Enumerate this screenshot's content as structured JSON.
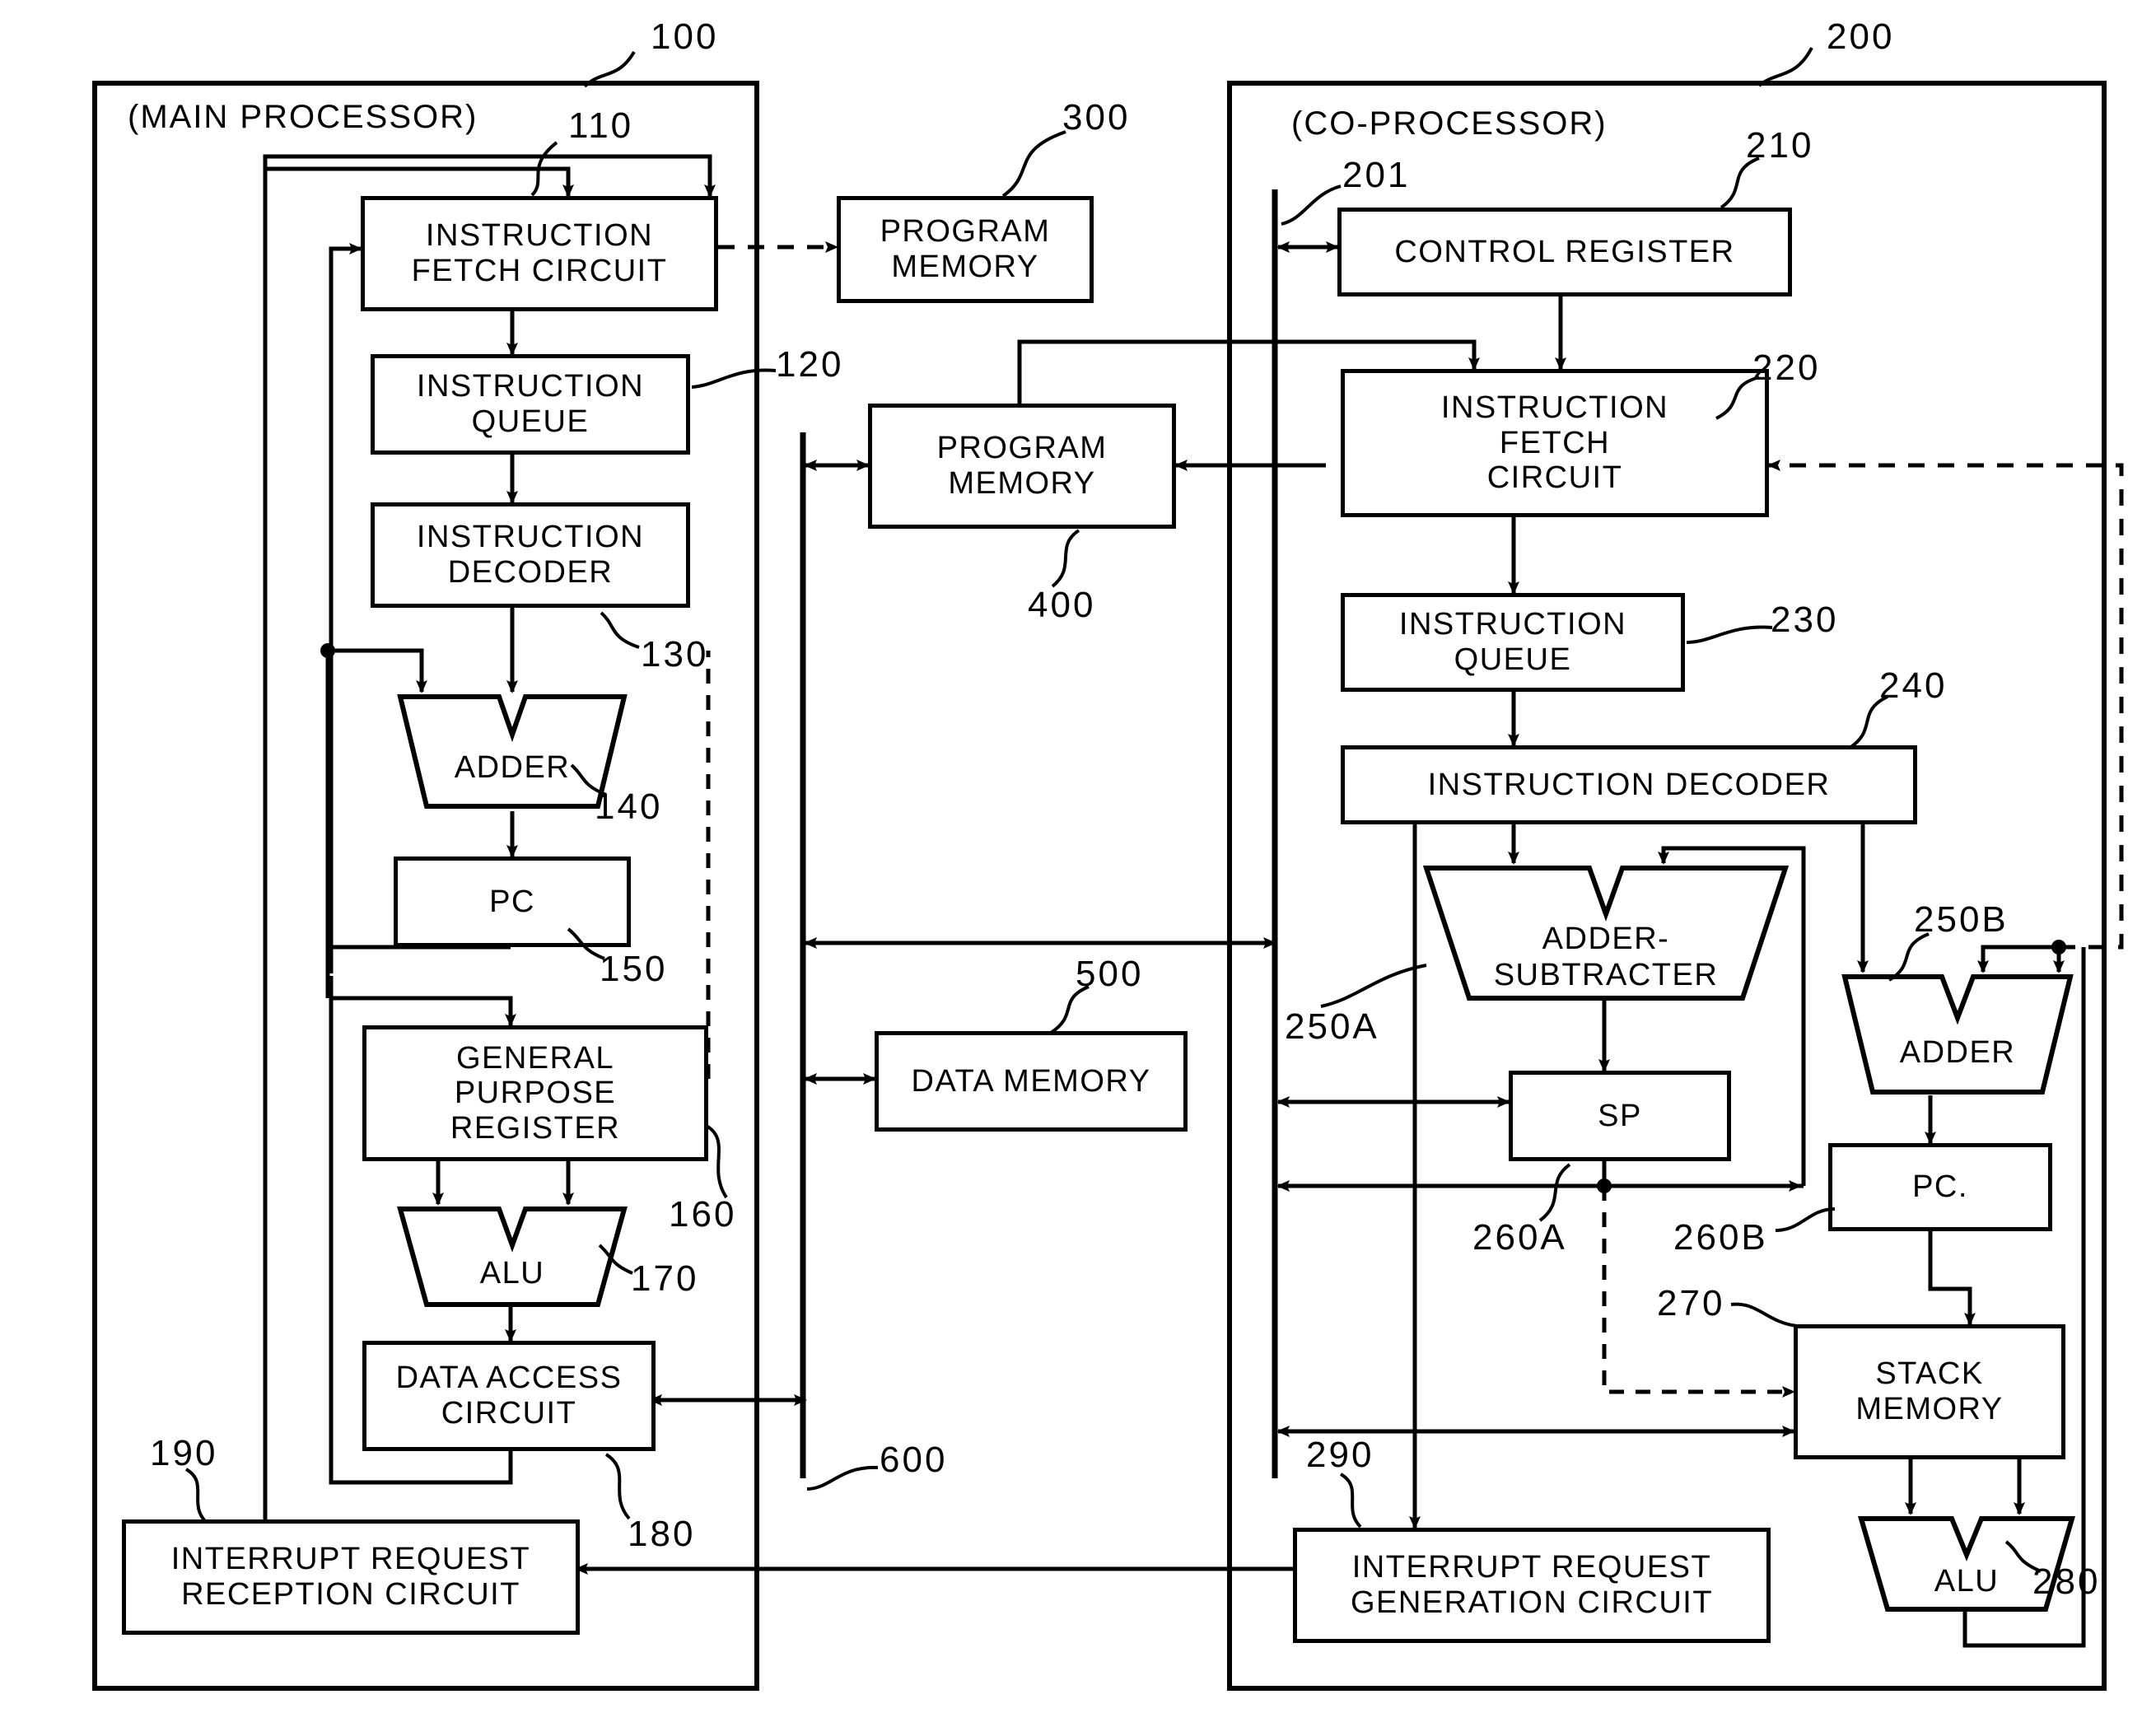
{
  "figure": {
    "type": "block-diagram",
    "title": "Processor system block diagram",
    "colors": {
      "ink": "#000000",
      "paper": "#ffffff"
    }
  },
  "frames": [
    {
      "key": "main",
      "title": "(MAIN PROCESSOR)",
      "ref": "100"
    },
    {
      "key": "co",
      "title": "(CO-PROCESSOR)",
      "ref": "200"
    }
  ],
  "main_processor": {
    "title": "(MAIN PROCESSOR)",
    "ref": "100",
    "blocks": [
      {
        "id": "ifc",
        "lines": [
          "INSTRUCTION",
          "FETCH CIRCUIT"
        ],
        "ref": "110"
      },
      {
        "id": "iq",
        "lines": [
          "INSTRUCTION",
          "QUEUE"
        ],
        "ref": "120"
      },
      {
        "id": "idec",
        "lines": [
          "INSTRUCTION",
          "DECODER"
        ],
        "ref": "130"
      },
      {
        "id": "adder",
        "lines": [
          "ADDER"
        ],
        "ref": "140",
        "shape": "trapezoid"
      },
      {
        "id": "pc",
        "lines": [
          "PC"
        ],
        "ref": "150"
      },
      {
        "id": "gpr",
        "lines": [
          "GENERAL",
          "PURPOSE",
          "REGISTER"
        ],
        "ref": "160"
      },
      {
        "id": "alu",
        "lines": [
          "ALU"
        ],
        "ref": "170",
        "shape": "trapezoid"
      },
      {
        "id": "dac",
        "lines": [
          "DATA ACCESS",
          "CIRCUIT"
        ],
        "ref": "180"
      },
      {
        "id": "irrc",
        "lines": [
          "INTERRUPT REQUEST",
          "RECEPTION CIRCUIT"
        ],
        "ref": "190"
      }
    ]
  },
  "co_processor": {
    "title": "(CO-PROCESSOR)",
    "ref": "200",
    "bus_ref": "201",
    "blocks": [
      {
        "id": "ctrl",
        "lines": [
          "CONTROL REGISTER"
        ],
        "ref": "210"
      },
      {
        "id": "ifc2",
        "lines": [
          "INSTRUCTION",
          "FETCH",
          "CIRCUIT"
        ],
        "ref": "220"
      },
      {
        "id": "iq2",
        "lines": [
          "INSTRUCTION",
          "QUEUE"
        ],
        "ref": "230"
      },
      {
        "id": "idec2",
        "lines": [
          "INSTRUCTION DECODER"
        ],
        "ref": "240"
      },
      {
        "id": "addsub",
        "lines": [
          "ADDER-",
          "SUBTRACTER"
        ],
        "ref": "250A",
        "shape": "trapezoid"
      },
      {
        "id": "adder2",
        "lines": [
          "ADDER"
        ],
        "ref": "250B",
        "shape": "trapezoid"
      },
      {
        "id": "sp",
        "lines": [
          "SP"
        ],
        "ref": "260A"
      },
      {
        "id": "pc2",
        "lines": [
          "PC"
        ],
        "ref": "260B"
      },
      {
        "id": "stack",
        "lines": [
          "STACK",
          "MEMORY"
        ],
        "ref": "270"
      },
      {
        "id": "alu2",
        "lines": [
          "ALU"
        ],
        "ref": "280",
        "shape": "trapezoid"
      },
      {
        "id": "irgc",
        "lines": [
          "INTERRUPT REQUEST",
          "GENERATION CIRCUIT"
        ],
        "ref": "290"
      }
    ]
  },
  "shared": {
    "blocks": [
      {
        "id": "pmem1",
        "lines": [
          "PROGRAM",
          "MEMORY"
        ],
        "ref": "300"
      },
      {
        "id": "pmem2",
        "lines": [
          "PROGRAM",
          "MEMORY"
        ],
        "ref": "400"
      },
      {
        "id": "dmem",
        "lines": [
          "DATA MEMORY"
        ],
        "ref": "500"
      }
    ],
    "bus": {
      "id": "bus",
      "ref": "600"
    }
  },
  "labels": {
    "main_title": "(MAIN PROCESSOR)",
    "co_title": "(CO-PROCESSOR)",
    "instruction": "INSTRUCTION",
    "fetch_circuit": "FETCH CIRCUIT",
    "fetch": "FETCH",
    "circuit": "CIRCUIT",
    "queue": "QUEUE",
    "decoder": "DECODER",
    "instruction_decoder": "INSTRUCTION DECODER",
    "adder": "ADDER",
    "adder_dash": "ADDER-",
    "subtracter": "SUBTRACTER",
    "pc": "PC",
    "pc_dot": "PC.",
    "sp": "SP",
    "alu": "ALU",
    "general": "GENERAL",
    "purpose": "PURPOSE",
    "register": "REGISTER",
    "control_register": "CONTROL REGISTER",
    "data_access": "DATA ACCESS",
    "stack": "STACK",
    "memory": "MEMORY",
    "program": "PROGRAM",
    "data_memory": "DATA MEMORY",
    "interrupt_request": "INTERRUPT REQUEST",
    "reception_circuit": "RECEPTION CIRCUIT",
    "generation_circuit": "GENERATION CIRCUIT"
  },
  "refs": {
    "r100": "100",
    "r110": "110",
    "r120": "120",
    "r130": "130",
    "r140": "140",
    "r150": "150",
    "r160": "160",
    "r170": "170",
    "r180": "180",
    "r190": "190",
    "r200": "200",
    "r201": "201",
    "r210": "210",
    "r220": "220",
    "r230": "230",
    "r240": "240",
    "r250A": "250A",
    "r250B": "250B",
    "r260A": "260A",
    "r260B": "260B",
    "r270": "270",
    "r280": "280",
    "r290": "290",
    "r300": "300",
    "r400": "400",
    "r500": "500",
    "r600": "600"
  }
}
